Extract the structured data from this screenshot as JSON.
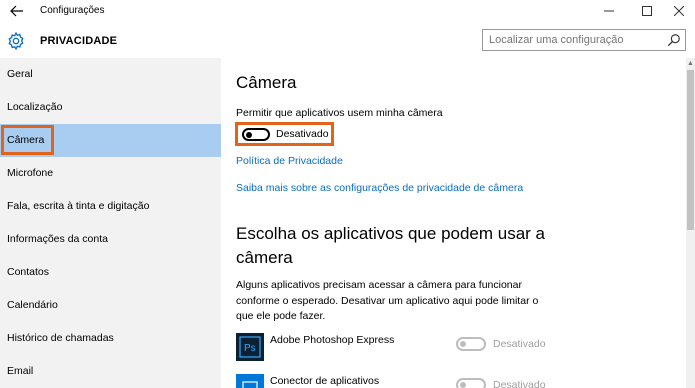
{
  "window": {
    "title": "Configurações",
    "back_icon": "arrow-left-icon",
    "controls": {
      "minimize": "—",
      "maximize": "☐",
      "close": "✕"
    }
  },
  "header": {
    "title": "PRIVACIDADE",
    "icon": "gear-icon",
    "accent_color": "#0a6cc4",
    "search": {
      "placeholder": "Localizar uma configuração",
      "value": ""
    }
  },
  "sidebar": {
    "items": [
      {
        "label": "Geral"
      },
      {
        "label": "Localização"
      },
      {
        "label": "Câmera",
        "selected": true
      },
      {
        "label": "Microfone"
      },
      {
        "label": "Fala, escrita à tinta e digitação"
      },
      {
        "label": "Informações da conta"
      },
      {
        "label": "Contatos"
      },
      {
        "label": "Calendário"
      },
      {
        "label": "Histórico de chamadas"
      },
      {
        "label": "Email"
      }
    ],
    "selected_color": "#a9cdf0",
    "highlight_color": "#e0641a"
  },
  "main": {
    "heading": "Câmera",
    "permission_label": "Permitir que aplicativos usem minha câmera",
    "toggle_state": "Desativado",
    "toggle_on": false,
    "links": {
      "privacy_policy": "Política de Privacidade",
      "learn_more": "Saiba mais sobre as configurações de privacidade de câmera"
    },
    "apps_heading": "Escolha os aplicativos que podem usar a câmera",
    "apps_description": "Alguns aplicativos precisam acessar a câmera para funcionar conforme o esperado. Desativar um aplicativo aqui pode limitar o que ele pode fazer.",
    "apps": [
      {
        "name": "Adobe Photoshop Express",
        "state": "Desativado",
        "icon": "photoshop-express-icon",
        "icon_text": "Ps"
      },
      {
        "name": "Conector de aplicativos",
        "state": "Desativado",
        "icon": "app-connector-icon"
      }
    ]
  }
}
